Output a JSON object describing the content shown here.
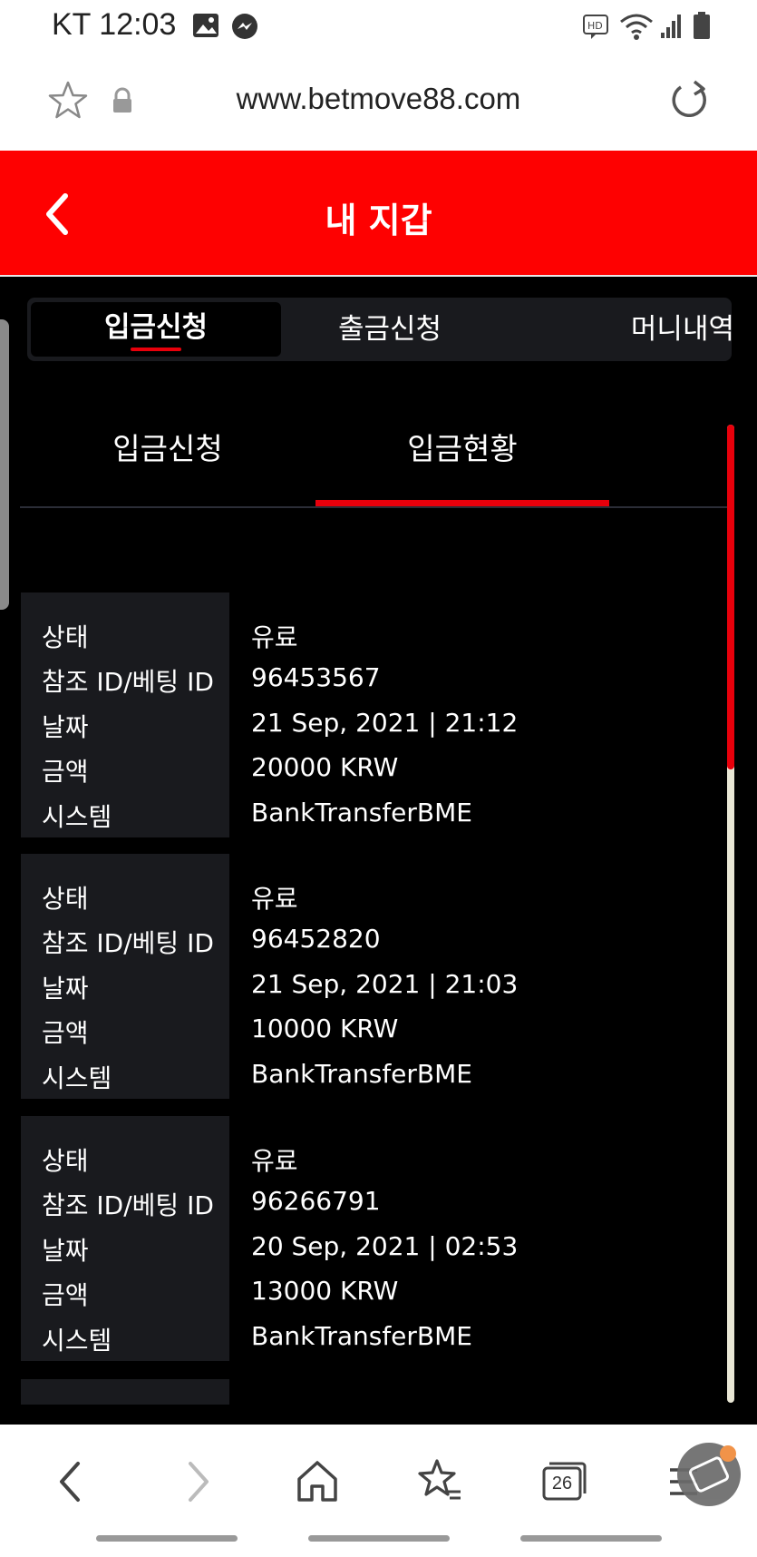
{
  "status_bar": {
    "carrier_time": "KT 12:03"
  },
  "url_bar": {
    "url": "www.betmove88.com"
  },
  "header": {
    "title": "내 지갑"
  },
  "main_tabs": [
    {
      "label": "입금신청",
      "active": true
    },
    {
      "label": "출금신청",
      "active": false
    },
    {
      "label": "머니내역",
      "active": false
    }
  ],
  "sub_tabs": [
    {
      "label": "입금신청",
      "active": false
    },
    {
      "label": "입금현황",
      "active": true
    }
  ],
  "records": [
    {
      "status_label": "상태",
      "status": "유료",
      "ref_label": "참조 ID/베팅 ID",
      "ref": "96453567",
      "date_label": "날짜",
      "date": "21 Sep, 2021 | 21:12",
      "amount_label": "금액",
      "amount": "20000 KRW",
      "system_label": "시스템",
      "system": "BankTransferBME"
    },
    {
      "status_label": "상태",
      "status": "유료",
      "ref_label": "참조 ID/베팅 ID",
      "ref": "96452820",
      "date_label": "날짜",
      "date": "21 Sep, 2021 | 21:03",
      "amount_label": "금액",
      "amount": "10000 KRW",
      "system_label": "시스템",
      "system": "BankTransferBME"
    },
    {
      "status_label": "상태",
      "status": "유료",
      "ref_label": "참조 ID/베팅 ID",
      "ref": "96266791",
      "date_label": "날짜",
      "date": "20 Sep, 2021 | 02:53",
      "amount_label": "금액",
      "amount": "13000 KRW",
      "system_label": "시스템",
      "system": "BankTransferBME"
    }
  ],
  "bottom_nav": {
    "tabs_count": "26"
  },
  "colors": {
    "accent": "#fe0101",
    "underline": "#e8000b",
    "panel": "#191a1e",
    "background": "#000000"
  }
}
